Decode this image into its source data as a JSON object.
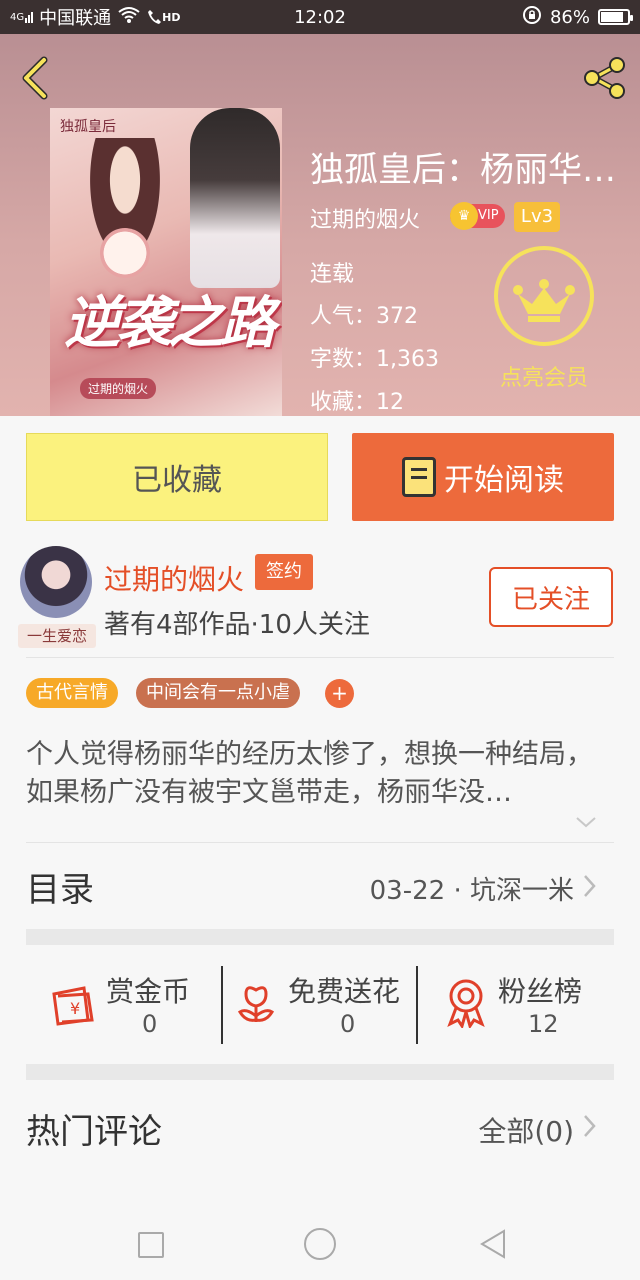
{
  "status_bar": {
    "network": "4G",
    "carrier": "中国联通",
    "hd": "HD",
    "time": "12:02",
    "battery_text": "86%",
    "battery_level": 0.86
  },
  "header": {
    "cover": {
      "small_title": "独孤皇后",
      "big_title": "逆袭之路",
      "author_tag": "过期的烟火"
    },
    "book_title": "独孤皇后：杨丽华…",
    "author": "过期的烟火",
    "vip_label": "VIP",
    "level": "Lv3",
    "status": "连载",
    "popularity": "人气：372",
    "word_count": "字数：1,363",
    "favorites": "收藏：12",
    "member_label": "点亮会员"
  },
  "actions": {
    "collected_label": "已收藏",
    "read_label": "开始阅读"
  },
  "author_block": {
    "avatar_tag": "一生爱恋",
    "name": "过期的烟火",
    "sign_badge": "签约",
    "stats": "著有4部作品·10人关注",
    "follow_label": "已关注"
  },
  "tags": [
    {
      "label": "古代言情",
      "color": "#f7a928"
    },
    {
      "label": "中间会有一点小虐",
      "color": "#c9714f"
    }
  ],
  "tag_add": "+",
  "description": "个人觉得杨丽华的经历太惨了，想换一种结局，如果杨广没有被宇文邕带走，杨丽华没…",
  "catalog": {
    "title": "目录",
    "latest": "03-22 · 坑深一米"
  },
  "stats": [
    {
      "label": "赏金币",
      "value": "0",
      "icon": "reward-coin-icon"
    },
    {
      "label": "免费送花",
      "value": "0",
      "icon": "flower-icon"
    },
    {
      "label": "粉丝榜",
      "value": "12",
      "icon": "ribbon-medal-icon"
    }
  ],
  "comments": {
    "title": "热门评论",
    "all_label": "全部(0)"
  },
  "colors": {
    "accent": "#ed6a3c",
    "accent_text": "#e44f27",
    "collected_bg": "#fbf27e",
    "member_gold": "#f6e25b"
  }
}
